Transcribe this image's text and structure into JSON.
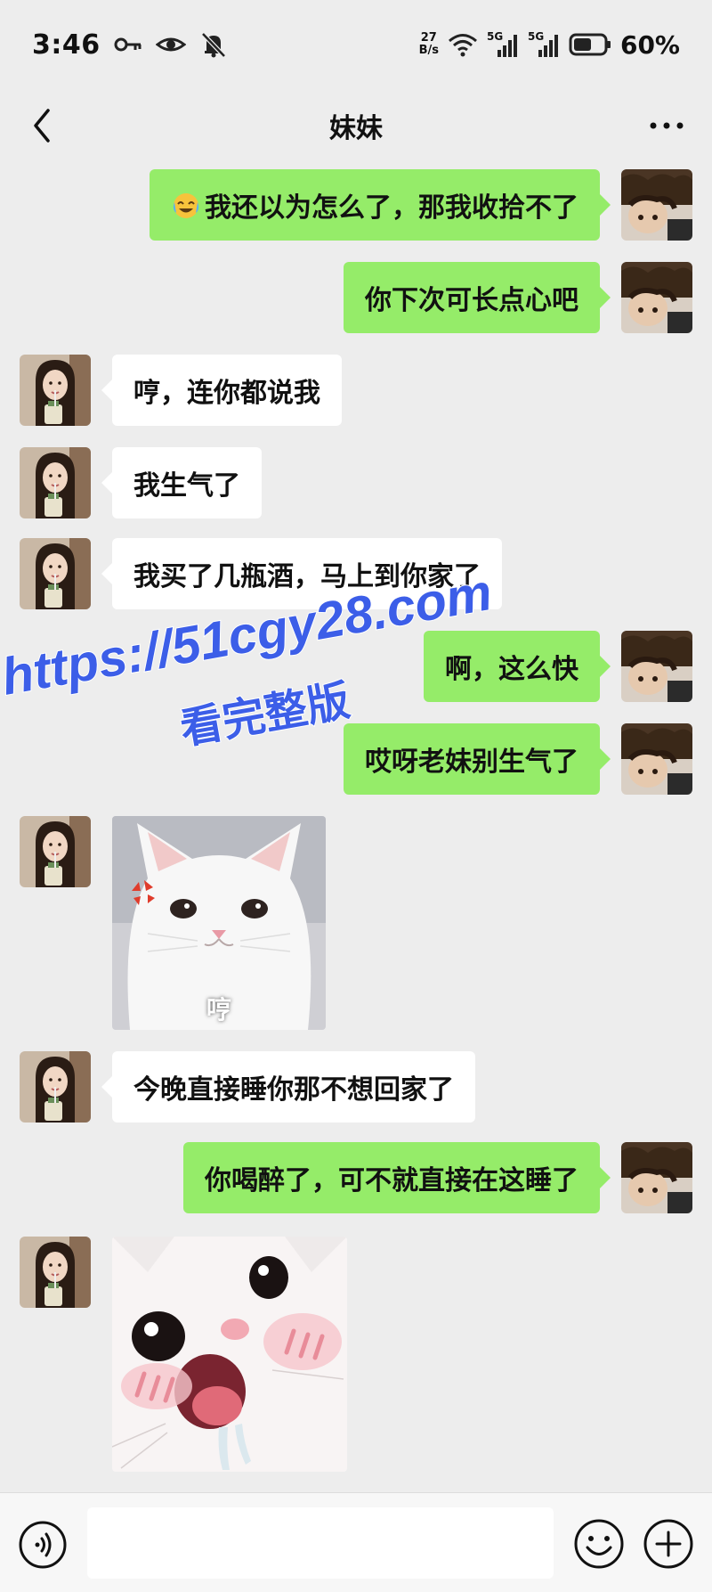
{
  "status_bar": {
    "time": "3:46",
    "net_speed_value": "27",
    "net_speed_unit": "B/s",
    "signal1_label": "5G",
    "signal2_label": "5G",
    "battery_percent": "60%",
    "battery_level": 0.6
  },
  "nav": {
    "title": "妹妹"
  },
  "messages": [
    {
      "side": "right",
      "type": "text",
      "text": "我还以为怎么了，那我收拾不了",
      "emoji": "laughing-crying-emoji"
    },
    {
      "side": "right",
      "type": "text",
      "text": "你下次可长点心吧"
    },
    {
      "side": "left",
      "type": "text",
      "text": "哼，连你都说我"
    },
    {
      "side": "left",
      "type": "text",
      "text": "我生气了"
    },
    {
      "side": "left",
      "type": "text",
      "text": "我买了几瓶酒，马上到你家了"
    },
    {
      "side": "right",
      "type": "text",
      "text": "啊，这么快"
    },
    {
      "side": "right",
      "type": "text",
      "text": "哎呀老妹别生气了"
    },
    {
      "side": "left",
      "type": "sticker",
      "caption": "哼",
      "sticker": "angry-white-cat"
    },
    {
      "side": "left",
      "type": "text",
      "text": "今晚直接睡你那不想回家了"
    },
    {
      "side": "right",
      "type": "text",
      "text": "你喝醉了，可不就直接在这睡了"
    },
    {
      "side": "left",
      "type": "sticker",
      "caption": "",
      "sticker": "drooling-white-cat"
    }
  ],
  "watermark": {
    "url": "https://51cgy28.com",
    "subtitle": "看完整版"
  },
  "input_bar": {
    "value": "",
    "placeholder": ""
  },
  "colors": {
    "background": "#ededed",
    "self_bubble": "#95ec69",
    "other_bubble": "#ffffff",
    "watermark": "#3c5ee8"
  }
}
